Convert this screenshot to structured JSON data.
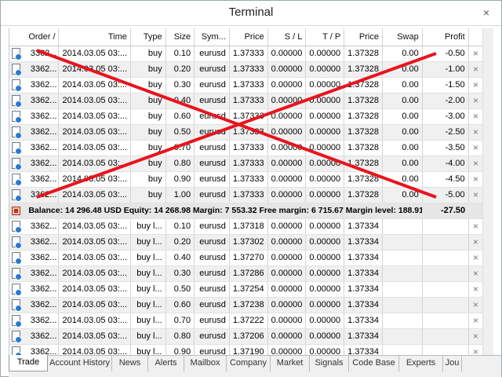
{
  "window": {
    "title": "Terminal",
    "close_glyph": "×"
  },
  "columns": [
    "Order",
    "Time",
    "Type",
    "Size",
    "Symbol",
    "Price",
    "S / L",
    "T / P",
    "Price",
    "Swap",
    "Profit"
  ],
  "columns_display": [
    "Order  /",
    "Time",
    "Type",
    "Size",
    "Sym...",
    "Price",
    "S / L",
    "T / P",
    "Price",
    "Swap",
    "Profit"
  ],
  "open_trades": [
    {
      "order": "3362...",
      "time": "2014.03.05 03:...",
      "type": "buy",
      "size": "0.10",
      "symbol": "eurusd",
      "price": "1.37333",
      "sl": "0.00000",
      "tp": "0.00000",
      "cur_price": "1.37328",
      "swap": "0.00",
      "profit": "-0.50"
    },
    {
      "order": "3362...",
      "time": "2014.03.05 03:...",
      "type": "buy",
      "size": "0.20",
      "symbol": "eurusd",
      "price": "1.37333",
      "sl": "0.00000",
      "tp": "0.00000",
      "cur_price": "1.37328",
      "swap": "0.00",
      "profit": "-1.00"
    },
    {
      "order": "3362...",
      "time": "2014.03.05 03:...",
      "type": "buy",
      "size": "0.30",
      "symbol": "eurusd",
      "price": "1.37333",
      "sl": "0.00000",
      "tp": "0.00000",
      "cur_price": "1.37328",
      "swap": "0.00",
      "profit": "-1.50"
    },
    {
      "order": "3362...",
      "time": "2014.03.05 03:...",
      "type": "buy",
      "size": "0.40",
      "symbol": "eurusd",
      "price": "1.37333",
      "sl": "0.00000",
      "tp": "0.00000",
      "cur_price": "1.37328",
      "swap": "0.00",
      "profit": "-2.00"
    },
    {
      "order": "3362...",
      "time": "2014.03.05 03:...",
      "type": "buy",
      "size": "0.60",
      "symbol": "eurusd",
      "price": "1.37333",
      "sl": "0.00000",
      "tp": "0.00000",
      "cur_price": "1.37328",
      "swap": "0.00",
      "profit": "-3.00"
    },
    {
      "order": "3362...",
      "time": "2014.03.05 03:...",
      "type": "buy",
      "size": "0.50",
      "symbol": "eurusd",
      "price": "1.37333",
      "sl": "0.00000",
      "tp": "0.00000",
      "cur_price": "1.37328",
      "swap": "0.00",
      "profit": "-2.50"
    },
    {
      "order": "3362...",
      "time": "2014.03.05 03:...",
      "type": "buy",
      "size": "0.70",
      "symbol": "eurusd",
      "price": "1.37333",
      "sl": "0.00000",
      "tp": "0.00000",
      "cur_price": "1.37328",
      "swap": "0.00",
      "profit": "-3.50"
    },
    {
      "order": "3362...",
      "time": "2014.03.05 03:...",
      "type": "buy",
      "size": "0.80",
      "symbol": "eurusd",
      "price": "1.37333",
      "sl": "0.00000",
      "tp": "0.00000",
      "cur_price": "1.37328",
      "swap": "0.00",
      "profit": "-4.00"
    },
    {
      "order": "3362...",
      "time": "2014.03.05 03:...",
      "type": "buy",
      "size": "0.90",
      "symbol": "eurusd",
      "price": "1.37333",
      "sl": "0.00000",
      "tp": "0.00000",
      "cur_price": "1.37328",
      "swap": "0.00",
      "profit": "-4.50"
    },
    {
      "order": "3362...",
      "time": "2014.03.05 03:...",
      "type": "buy",
      "size": "1.00",
      "symbol": "eurusd",
      "price": "1.37333",
      "sl": "0.00000",
      "tp": "0.00000",
      "cur_price": "1.37328",
      "swap": "0.00",
      "profit": "-5.00"
    }
  ],
  "summary": {
    "text": "Balance: 14 296.48 USD  Equity: 14 268.98  Margin: 7 553.32  Free margin: 6 715.67  Margin level: 188.91%",
    "total": "-27.50"
  },
  "pending_orders": [
    {
      "order": "3362...",
      "time": "2014.03.05 03:...",
      "type": "buy l...",
      "size": "0.10",
      "symbol": "eurusd",
      "price": "1.37318",
      "sl": "0.00000",
      "tp": "0.00000",
      "cur_price": "1.37334"
    },
    {
      "order": "3362...",
      "time": "2014.03.05 03:...",
      "type": "buy l...",
      "size": "0.20",
      "symbol": "eurusd",
      "price": "1.37302",
      "sl": "0.00000",
      "tp": "0.00000",
      "cur_price": "1.37334"
    },
    {
      "order": "3362...",
      "time": "2014.03.05 03:...",
      "type": "buy l...",
      "size": "0.40",
      "symbol": "eurusd",
      "price": "1.37270",
      "sl": "0.00000",
      "tp": "0.00000",
      "cur_price": "1.37334"
    },
    {
      "order": "3362...",
      "time": "2014.03.05 03:...",
      "type": "buy l...",
      "size": "0.30",
      "symbol": "eurusd",
      "price": "1.37286",
      "sl": "0.00000",
      "tp": "0.00000",
      "cur_price": "1.37334"
    },
    {
      "order": "3362...",
      "time": "2014.03.05 03:...",
      "type": "buy l...",
      "size": "0.50",
      "symbol": "eurusd",
      "price": "1.37254",
      "sl": "0.00000",
      "tp": "0.00000",
      "cur_price": "1.37334"
    },
    {
      "order": "3362...",
      "time": "2014.03.05 03:...",
      "type": "buy l...",
      "size": "0.60",
      "symbol": "eurusd",
      "price": "1.37238",
      "sl": "0.00000",
      "tp": "0.00000",
      "cur_price": "1.37334"
    },
    {
      "order": "3362...",
      "time": "2014.03.05 03:...",
      "type": "buy l...",
      "size": "0.70",
      "symbol": "eurusd",
      "price": "1.37222",
      "sl": "0.00000",
      "tp": "0.00000",
      "cur_price": "1.37334"
    },
    {
      "order": "3362...",
      "time": "2014.03.05 03:...",
      "type": "buy l...",
      "size": "0.80",
      "symbol": "eurusd",
      "price": "1.37206",
      "sl": "0.00000",
      "tp": "0.00000",
      "cur_price": "1.37334"
    },
    {
      "order": "3362...",
      "time": "2014.03.05 03:...",
      "type": "buy l...",
      "size": "0.90",
      "symbol": "eurusd",
      "price": "1.37190",
      "sl": "0.00000",
      "tp": "0.00000",
      "cur_price": "1.37334"
    }
  ],
  "close_glyph": "×",
  "tabs": [
    "Trade",
    "Account History",
    "News",
    "Alerts",
    "Mailbox",
    "Company",
    "Market",
    "Signals",
    "Code Base",
    "Experts",
    "Jou"
  ],
  "active_tab": "Trade",
  "colors": {
    "cross_out": "#e8141e",
    "row_alt": "#f0f0f0",
    "summary_bg": "#e6e6e6"
  }
}
